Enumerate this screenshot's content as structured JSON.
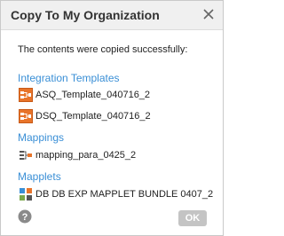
{
  "dialog": {
    "title": "Copy To My Organization",
    "message": "The contents were copied successfully:",
    "ok_label": "OK"
  },
  "sections": [
    {
      "heading": "Integration Templates",
      "items": [
        {
          "label": "ASQ_Template_040716_2",
          "icon": "integration-template-icon"
        },
        {
          "label": "DSQ_Template_040716_2",
          "icon": "integration-template-icon"
        }
      ]
    },
    {
      "heading": "Mappings",
      "items": [
        {
          "label": "mapping_para_0425_2",
          "icon": "mapping-icon"
        }
      ]
    },
    {
      "heading": "Mapplets",
      "items": [
        {
          "label": "DB DB EXP MAPPLET BUNDLE 0407_2",
          "icon": "mapplet-icon"
        }
      ]
    }
  ],
  "colors": {
    "section_heading": "#3a8fd6",
    "template_icon": "#e8742a",
    "ok_button": "#c4c4c4",
    "help_icon": "#8a8a8a"
  }
}
